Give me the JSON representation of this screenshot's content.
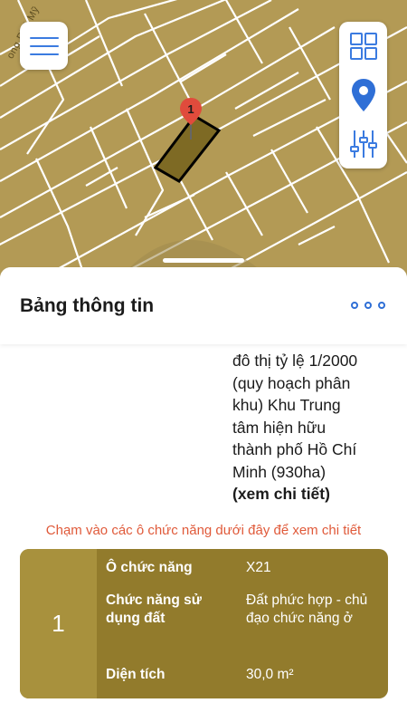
{
  "map": {
    "street_label": "ong Phú Mỹ",
    "marker_label": "1",
    "menu_icon": "hamburger-menu-icon",
    "layers_icon": "grid-layers-icon",
    "location_icon": "location-pin-icon",
    "filter_icon": "sliders-icon",
    "land_color": "#b39a55",
    "parcel_color": "#7e6a24"
  },
  "sheet": {
    "title": "Bảng thông tin",
    "more_icon": "more-options-icon",
    "description_lines": [
      "đô thị tỷ lệ 1/2000",
      "(quy hoạch phân",
      "khu) Khu Trung",
      "tâm hiện hữu",
      "thành phố Hồ Chí",
      "Minh (930ha)"
    ],
    "detail_link": "(xem chi tiết)",
    "hint": "Chạm vào các ô chức năng dưới đây để xem chi tiết"
  },
  "function_card": {
    "index": "1",
    "rows": [
      {
        "label": "Ô chức năng",
        "value": "X21"
      },
      {
        "label": "Chức năng sử dụng đất",
        "value": "Đất phức hợp - chủ đạo chức năng ở"
      },
      {
        "label": "Diện tích",
        "value": "30,0 m²"
      }
    ],
    "card_color": "#927b2c",
    "accent_color": "#e05a3a"
  }
}
